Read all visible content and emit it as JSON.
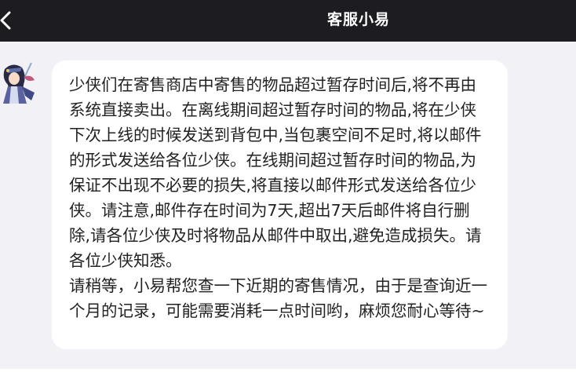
{
  "header": {
    "title": "客服小易",
    "back_icon": "chevron-left-icon"
  },
  "chat": {
    "agent_avatar": "avatar-image",
    "messages": [
      {
        "sender": "agent",
        "text": "少侠们在寄售商店中寄售的物品超过暂存时间后,将不再由系统直接卖出。在离线期间超过暂存时间的物品,将在少侠下次上线的时候发送到背包中,当包裹空间不足时,将以邮件的形式发送给各位少侠。在线期间超过暂存时间的物品,为保证不出现不必要的损失,将直接以邮件形式发送给各位少侠。请注意,邮件存在时间为7天,超出7天后邮件将自行删除,请各位少侠及时将物品从邮件中取出,避免造成损失。请各位少侠知悉。",
        "text2": "请稍等，小易帮您查一下近期的寄售情况，由于是查询近一个月的记录，可能需要消耗一点时间哟，麻烦您耐心等待~"
      }
    ]
  },
  "colors": {
    "header_bg": "#1d1d21",
    "chat_bg": "#f2f2f6",
    "bubble_bg": "#ffffff",
    "text": "#222222"
  }
}
